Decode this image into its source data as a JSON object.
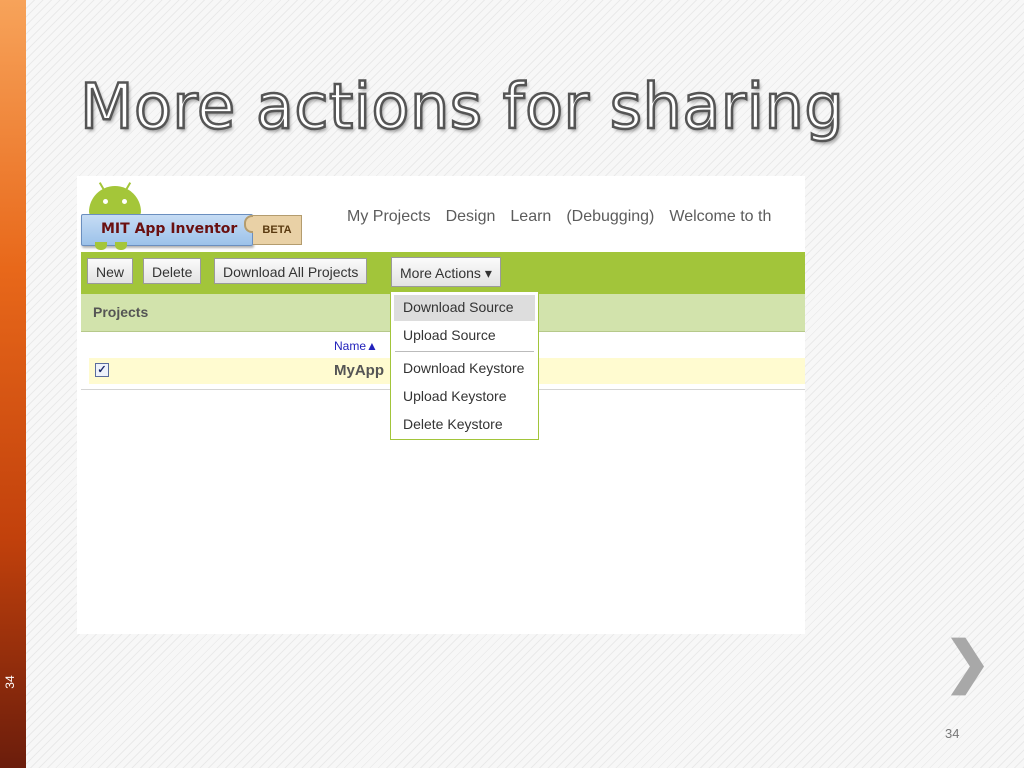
{
  "slide": {
    "title": "More actions for sharing",
    "side_number": "34",
    "page_number": "34",
    "next_arrow": "❯"
  },
  "app": {
    "logo_text": "MIT App Inventor",
    "beta_label": "BETA",
    "nav": [
      "My Projects",
      "Design",
      "Learn",
      "(Debugging)",
      "Welcome to th"
    ]
  },
  "toolbar": {
    "new_label": "New",
    "delete_label": "Delete",
    "download_all_label": "Download All Projects",
    "more_actions_label": "More Actions ▾"
  },
  "projects": {
    "title": "Projects",
    "name_header": "Name▲",
    "rows": [
      {
        "name": "MyApp",
        "checked": true
      }
    ]
  },
  "menu": {
    "items": [
      "Download Source",
      "Upload Source",
      "Download Keystore",
      "Upload Keystore",
      "Delete Keystore"
    ]
  },
  "colors": {
    "accent_orange": "#e8681a",
    "toolbar_green": "#a2c53a",
    "projects_bar": "#d2e3ac",
    "selected_row": "#fffbd0"
  }
}
